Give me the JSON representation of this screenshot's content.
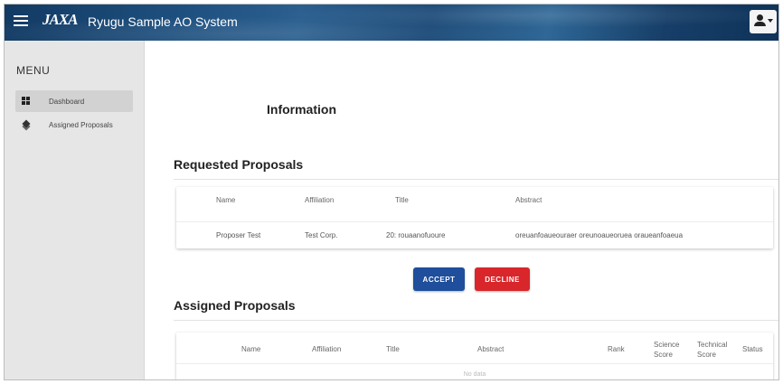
{
  "header": {
    "logo": "JAXA",
    "title": "Ryugu Sample AO System"
  },
  "sidebar": {
    "menu_label": "MENU",
    "items": [
      {
        "label": "Dashboard",
        "icon": "dashboard-icon",
        "active": true
      },
      {
        "label": "Assigned Proposals",
        "icon": "layers-icon",
        "active": false
      }
    ]
  },
  "main": {
    "info_title": "Information",
    "requested": {
      "title": "Requested Proposals",
      "columns": [
        "Name",
        "Affiliation",
        "Title",
        "Abstract"
      ],
      "rows": [
        {
          "name": "Proposer Test",
          "affiliation": "Test Corp.",
          "title": "20: rouaanofuoure",
          "abstract": "oreuanfoaueouraer oreunoaueoruea oraueanfoaeua"
        }
      ]
    },
    "actions": {
      "accept_label": "ACCEPT",
      "decline_label": "DECLINE"
    },
    "assigned": {
      "title": "Assigned Proposals",
      "columns": [
        "Name",
        "Affiliation",
        "Title",
        "Abstract",
        "Rank",
        "Science Score",
        "Technical Score",
        "Status"
      ],
      "empty_text": "No data"
    }
  },
  "colors": {
    "accept": "#1e4e9c",
    "decline": "#d8262b",
    "sidebar_bg": "#e6e6e6"
  }
}
